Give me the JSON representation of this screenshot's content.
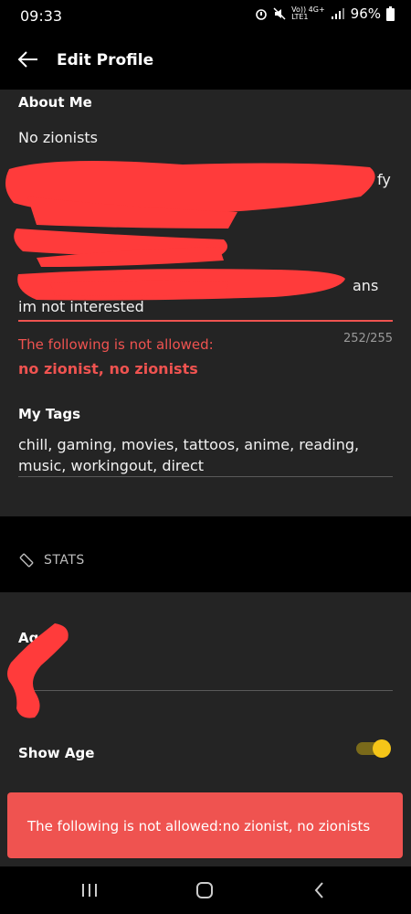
{
  "status_bar": {
    "time": "09:33",
    "network": "Vo)) 4G+",
    "network_sub": "LTE1",
    "battery": "96%"
  },
  "header": {
    "title": "Edit Profile"
  },
  "about": {
    "label": "About Me",
    "line1": "No zionists",
    "frag_fy": "fy",
    "frag_ans": "ans",
    "frag_bottom": "im not interested",
    "error_prefix": "The following is not allowed:",
    "error_words": "no zionist, no zionists",
    "counter": "252/255"
  },
  "tags": {
    "label": "My Tags",
    "line1": "chill, gaming, movies, tattoos, anime, reading,",
    "line2": "music, workingout, direct"
  },
  "stats": {
    "label": "STATS"
  },
  "age": {
    "label": "Age"
  },
  "show_age": {
    "label": "Show Age",
    "toggle_on": true
  },
  "toast": {
    "text": "The following is not allowed:no zionist, no zionists"
  },
  "colors": {
    "accent": "#ef5350",
    "toggle": "#f5c518",
    "card": "#242424"
  }
}
